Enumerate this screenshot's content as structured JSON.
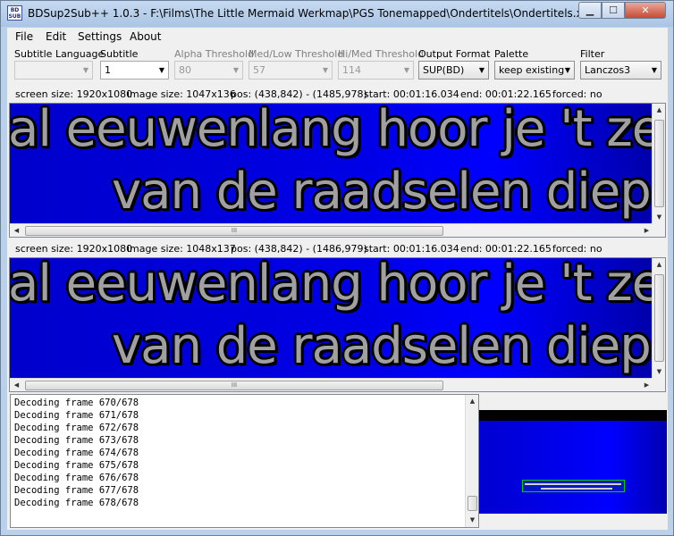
{
  "window": {
    "title": "BDSup2Sub++ 1.0.3 - F:\\Films\\The Little Mermaid Werkmap\\PGS Tonemapped\\Ondertitels\\Ondertitels.xml",
    "icon_text": "BD SUB",
    "min_glyph": "▁",
    "max_glyph": "☐",
    "close_glyph": "✕"
  },
  "menu": [
    "File",
    "Edit",
    "Settings",
    "About"
  ],
  "controls": {
    "subtitle_language": {
      "label": "Subtitle Language",
      "value": ""
    },
    "subtitle": {
      "label": "Subtitle",
      "value": "1"
    },
    "alpha_threshold": {
      "label": "Alpha Threshold",
      "value": "80"
    },
    "medlow_threshold": {
      "label": "Med/Low Threshold",
      "value": "57"
    },
    "himed_threshold": {
      "label": "Hi/Med Threshold",
      "value": "114"
    },
    "output_format": {
      "label": "Output Format",
      "value": "SUP(BD)"
    },
    "palette": {
      "label": "Palette",
      "value": "keep existing"
    },
    "filter": {
      "label": "Filter",
      "value": "Lanczos3"
    }
  },
  "source_info": {
    "screen_size": "screen size: 1920x1080",
    "image_size": "image size: 1047x136",
    "pos": "pos: (438,842) - (1485,978)",
    "start": "start: 00:01:16.034",
    "end": "end: 00:01:22.165",
    "forced": "forced: no"
  },
  "target_info": {
    "screen_size": "screen size: 1920x1080",
    "image_size": "image size: 1048x137",
    "pos": "pos: (438,842) - (1486,979)",
    "start": "start: 00:01:16.034",
    "end": "end: 00:01:22.165",
    "forced": "forced: no"
  },
  "subtitle_text": {
    "line1": "al eeuwenlang hoor je 't zee",
    "line2": "van de raadselen diep i"
  },
  "scroll_glyphs": {
    "up": "▲",
    "down": "▼",
    "left": "◀",
    "right": "▶",
    "grip": "III"
  },
  "log": [
    "Decoding frame 670/678",
    "Decoding frame 671/678",
    "Decoding frame 672/678",
    "Decoding frame 673/678",
    "Decoding frame 674/678",
    "Decoding frame 675/678",
    "Decoding frame 676/678",
    "Decoding frame 677/678",
    "Decoding frame 678/678"
  ]
}
